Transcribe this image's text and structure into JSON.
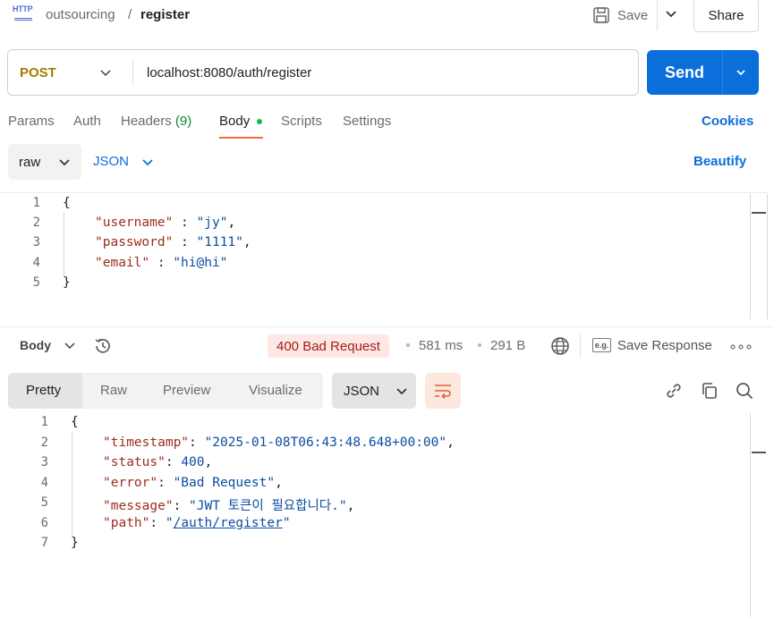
{
  "header": {
    "http_icon": "HTTP",
    "breadcrumb_parent": "outsourcing",
    "breadcrumb_separator": "/",
    "breadcrumb_current": "register",
    "save_label": "Save",
    "share_label": "Share"
  },
  "request": {
    "method": "POST",
    "url": "localhost:8080/auth/register",
    "send_label": "Send",
    "tabs": [
      {
        "label": "Params"
      },
      {
        "label": "Auth"
      },
      {
        "label": "Headers",
        "count": "(9)"
      },
      {
        "label": "Body"
      },
      {
        "label": "Scripts"
      },
      {
        "label": "Settings"
      }
    ],
    "active_tab": "Body",
    "cookies_label": "Cookies",
    "body_mode": "raw",
    "body_format": "JSON",
    "beautify_label": "Beautify",
    "body_lines": {
      "l1": "{",
      "l2_key": "\"username\"",
      "l2_val": "\"jy\"",
      "l3_key": "\"password\"",
      "l3_val": "\"1111\"",
      "l4_key": "\"email\"",
      "l4_val": "\"hi@hi\"",
      "l5": "}"
    },
    "line_numbers": [
      "1",
      "2",
      "3",
      "4",
      "5"
    ]
  },
  "response": {
    "body_label": "Body",
    "status": "400 Bad Request",
    "time": "581 ms",
    "size": "291 B",
    "eg_icon": "e.g.",
    "save_response_label": "Save Response",
    "more_icon": "∘∘∘",
    "view_tabs": [
      {
        "label": "Pretty"
      },
      {
        "label": "Raw"
      },
      {
        "label": "Preview"
      },
      {
        "label": "Visualize"
      }
    ],
    "active_view": "Pretty",
    "format": "JSON",
    "line_numbers": [
      "1",
      "2",
      "3",
      "4",
      "5",
      "6",
      "7"
    ],
    "body_lines": {
      "l1": "{",
      "timestamp_key": "\"timestamp\"",
      "timestamp_val": "\"2025-01-08T06:43:48.648+00:00\"",
      "status_key": "\"status\"",
      "status_val": "400",
      "error_key": "\"error\"",
      "error_val": "\"Bad Request\"",
      "message_key": "\"message\"",
      "message_val": "\"JWT 토큰이 필요합니다.\"",
      "path_key": "\"path\"",
      "path_quote_open": "\"",
      "path_val": "/auth/register",
      "path_quote_close": "\"",
      "l7": "}"
    }
  },
  "colors": {
    "accent": "#0a6fdb",
    "method": "#a57c00",
    "status_bg": "#fde8e6",
    "status_text": "#a11d13",
    "json_key": "#9c2d20",
    "json_value": "#0b4fa3",
    "active_tab_underline": "#f26b3a"
  }
}
